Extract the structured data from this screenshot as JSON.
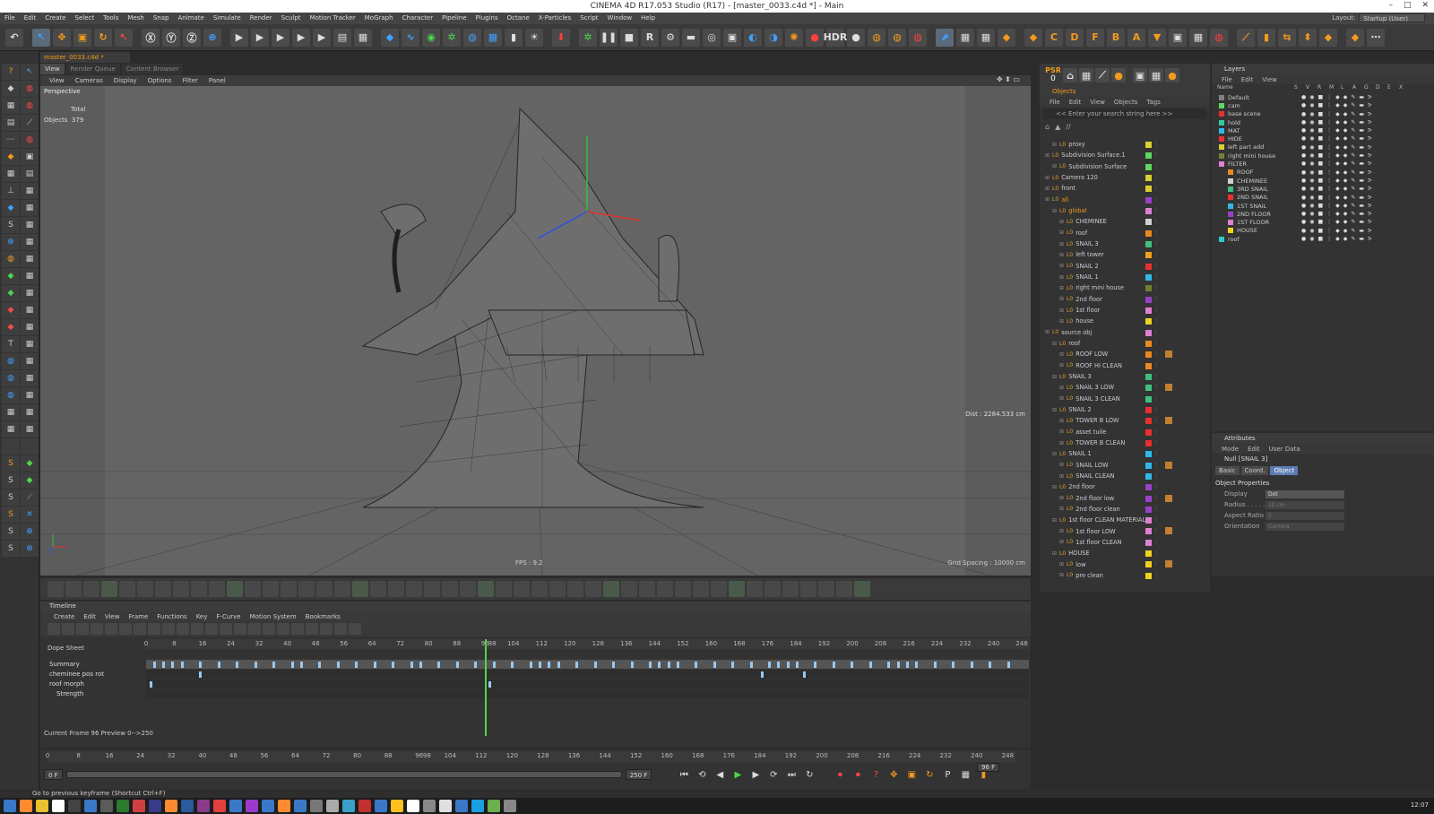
{
  "window": {
    "title": "CINEMA 4D R17.053 Studio (R17) - [master_0033.c4d *] - Main",
    "controls": [
      "–",
      "□",
      "✕"
    ]
  },
  "menu": [
    "File",
    "Edit",
    "Create",
    "Select",
    "Tools",
    "Mesh",
    "Snap",
    "Animate",
    "Simulate",
    "Render",
    "Sculpt",
    "Motion Tracker",
    "MoGraph",
    "Character",
    "Pipeline",
    "Plugins",
    "Octane",
    "X-Particles",
    "Script",
    "Window",
    "Help"
  ],
  "layout": {
    "label": "Layout:",
    "value": "Startup (User)"
  },
  "doc_tab": "master_0033.c4d *",
  "view_tabs": [
    "View",
    "Render Queue",
    "Content Browser"
  ],
  "viewport_menu": [
    "View",
    "Cameras",
    "Display",
    "Options",
    "Filter",
    "Panel"
  ],
  "viewport": {
    "label": "Perspective",
    "stats_header": "Total",
    "stats_label": "Objects",
    "stats_value": "379",
    "dist": "Dist : 2284.533 cm",
    "fps": "FPS : 9.2",
    "grid": "Grid Spacing : 10000 cm"
  },
  "timeline": {
    "title": "Timeline",
    "menu": [
      "Create",
      "Edit",
      "View",
      "Frame",
      "Functions",
      "Key",
      "F-Curve",
      "Motion System",
      "Bookmarks"
    ],
    "dope": "Dope Sheet",
    "ticks": [
      "0",
      "8",
      "16",
      "24",
      "32",
      "40",
      "48",
      "56",
      "64",
      "72",
      "80",
      "88",
      "96",
      "98",
      "104",
      "112",
      "120",
      "128",
      "136",
      "144",
      "152",
      "160",
      "168",
      "176",
      "184",
      "192",
      "200",
      "208",
      "216",
      "224",
      "232",
      "240",
      "248"
    ],
    "tracks": [
      "Summary",
      "cheminee pos rot",
      "roof morph",
      "Strength"
    ],
    "status": "Current Frame  96  Preview  0-->250",
    "current_frame": 96
  },
  "transport": {
    "start": "0 F",
    "end": "250 F",
    "cur": "96 F",
    "ticks": [
      "0",
      "8",
      "16",
      "24",
      "32",
      "40",
      "48",
      "56",
      "64",
      "72",
      "80",
      "88",
      "96",
      "98",
      "104",
      "112",
      "120",
      "128",
      "136",
      "144",
      "152",
      "160",
      "168",
      "176",
      "184",
      "192",
      "200",
      "208",
      "216",
      "224",
      "232",
      "240",
      "248"
    ]
  },
  "status_text": "Go to previous keyframe (Shortcut Ctrl+F)",
  "clock": "12:07",
  "psr": {
    "label": "PSR",
    "value": "0"
  },
  "objects": {
    "title": "Objects",
    "menu": [
      "File",
      "Edit",
      "View",
      "Objects",
      "Tags"
    ],
    "search": "<< Enter your search string here >>",
    "items": [
      {
        "name": "proxy",
        "indent": 1,
        "color": "#d8d030"
      },
      {
        "name": "Subdivision Surface.1",
        "indent": 0,
        "color": "#5cd85c"
      },
      {
        "name": "Subdivision Surface",
        "indent": 1,
        "color": "#5cd85c"
      },
      {
        "name": "Camera 120",
        "indent": 0,
        "color": "#d8d030"
      },
      {
        "name": "front",
        "indent": 0,
        "color": "#d8d030"
      },
      {
        "name": "all",
        "indent": 0,
        "color": "#9a40c8"
      },
      {
        "name": "global",
        "indent": 1,
        "color": "#e080d0"
      },
      {
        "name": "CHEMINEE",
        "indent": 2,
        "color": "#d0d0d0"
      },
      {
        "name": "roof",
        "indent": 2,
        "color": "#e88a20"
      },
      {
        "name": "SNAIL 3",
        "indent": 2,
        "color": "#40c080"
      },
      {
        "name": "left tower",
        "indent": 2,
        "color": "#f0a020"
      },
      {
        "name": "SNAIL 2",
        "indent": 2,
        "color": "#e83030"
      },
      {
        "name": "SNAIL 1",
        "indent": 2,
        "color": "#30b8e8"
      },
      {
        "name": "right mini house",
        "indent": 2,
        "color": "#708030"
      },
      {
        "name": "2nd floor",
        "indent": 2,
        "color": "#9a40c8"
      },
      {
        "name": "1st floor",
        "indent": 2,
        "color": "#e080d0"
      },
      {
        "name": "house",
        "indent": 2,
        "color": "#f0d020"
      },
      {
        "name": "source obj",
        "indent": 0,
        "color": "#e080d0"
      },
      {
        "name": "roof",
        "indent": 1,
        "color": "#e88a20"
      },
      {
        "name": "ROOF LOW",
        "indent": 2,
        "color": "#e88a20"
      },
      {
        "name": "ROOF HI CLEAN",
        "indent": 2,
        "color": "#e88a20"
      },
      {
        "name": "SNAIL 3",
        "indent": 1,
        "color": "#40c080"
      },
      {
        "name": "SNAIL 3 LOW",
        "indent": 2,
        "color": "#40c080"
      },
      {
        "name": "SNAIL 3 CLEAN",
        "indent": 2,
        "color": "#40c080"
      },
      {
        "name": "SNAIL 2",
        "indent": 1,
        "color": "#e83030"
      },
      {
        "name": "TOWER B LOW",
        "indent": 2,
        "color": "#e83030"
      },
      {
        "name": "asset tuile",
        "indent": 2,
        "color": "#e83030"
      },
      {
        "name": "TOWER B CLEAN",
        "indent": 2,
        "color": "#e83030"
      },
      {
        "name": "SNAIL 1",
        "indent": 1,
        "color": "#30b8e8"
      },
      {
        "name": "SNAIL LOW",
        "indent": 2,
        "color": "#30b8e8"
      },
      {
        "name": "SNAIL CLEAN",
        "indent": 2,
        "color": "#30b8e8"
      },
      {
        "name": "2nd floor",
        "indent": 1,
        "color": "#9a40c8"
      },
      {
        "name": "2nd floor low",
        "indent": 2,
        "color": "#9a40c8"
      },
      {
        "name": "2nd floor clean",
        "indent": 2,
        "color": "#9a40c8"
      },
      {
        "name": "1st floor CLEAN MATERIAL",
        "indent": 1,
        "color": "#e080d0"
      },
      {
        "name": "1st floor LOW",
        "indent": 2,
        "color": "#e080d0"
      },
      {
        "name": "1st floor CLEAN",
        "indent": 2,
        "color": "#e080d0"
      },
      {
        "name": "HOUSE",
        "indent": 1,
        "color": "#f0d020"
      },
      {
        "name": "low",
        "indent": 2,
        "color": "#f0d020"
      },
      {
        "name": "pre clean",
        "indent": 2,
        "color": "#f0d020"
      }
    ]
  },
  "layers": {
    "title": "Layers",
    "menu": [
      "File",
      "Edit",
      "View"
    ],
    "col_name": "Name",
    "cols": [
      "S",
      "V",
      "R",
      "M",
      "L",
      "A",
      "G",
      "D",
      "E",
      "X"
    ],
    "items": [
      {
        "name": "Default",
        "color": "#808080"
      },
      {
        "name": "cam",
        "color": "#5cd85c"
      },
      {
        "name": "base scene",
        "color": "#e83030"
      },
      {
        "name": "hold",
        "color": "#30c8a0"
      },
      {
        "name": "MAT",
        "color": "#30b8e8"
      },
      {
        "name": "HIDE",
        "color": "#e83030"
      },
      {
        "name": "left part add",
        "color": "#d8d030"
      },
      {
        "name": "right mini house",
        "color": "#708030"
      },
      {
        "name": "FILTER",
        "color": "#e080d0"
      },
      {
        "name": "ROOF",
        "color": "#e88a20"
      },
      {
        "name": "CHEMINEE",
        "color": "#d0d0d0"
      },
      {
        "name": "3RD SNAIL",
        "color": "#40c080"
      },
      {
        "name": "2ND SNAIL",
        "color": "#e83030"
      },
      {
        "name": "1ST SNAIL",
        "color": "#30b8e8"
      },
      {
        "name": "2ND FLOOR",
        "color": "#9a40c8"
      },
      {
        "name": "1ST FLOOR",
        "color": "#e080d0"
      },
      {
        "name": "HOUSE",
        "color": "#f0d020"
      },
      {
        "name": "roof",
        "color": "#30c8c8"
      }
    ]
  },
  "attributes": {
    "title": "Attributes",
    "menu": [
      "Mode",
      "Edit",
      "User Data"
    ],
    "object": "Null [SNAIL 3]",
    "tabs": [
      "Basic",
      "Coord.",
      "Object"
    ],
    "section": "Object Properties",
    "props": [
      {
        "label": "Display",
        "value": "Dot",
        "enabled": true
      },
      {
        "label": "Radius . . . . .",
        "value": "10 cm",
        "enabled": false
      },
      {
        "label": "Aspect Ratio",
        "value": "1",
        "enabled": false
      },
      {
        "label": "Orientation",
        "value": "Camera",
        "enabled": false
      }
    ]
  }
}
